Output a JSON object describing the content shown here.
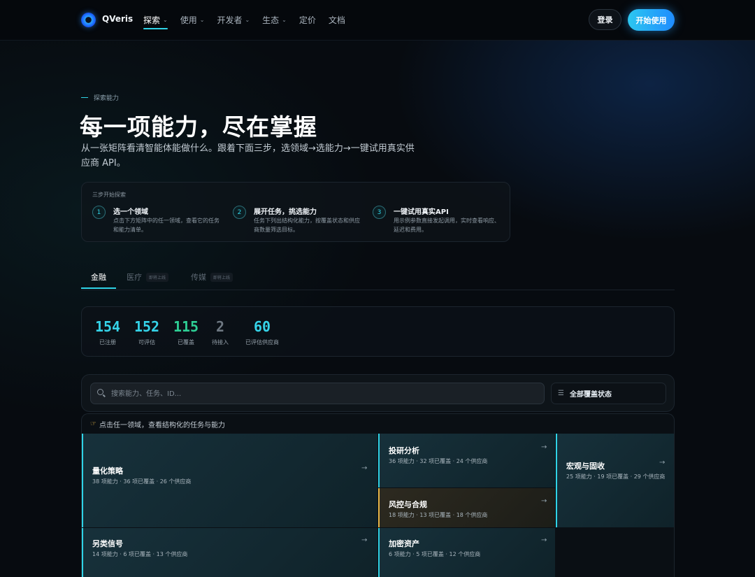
{
  "nav": {
    "brand": "QVeris",
    "items": [
      {
        "label": "探索",
        "dropdown": true,
        "active": true
      },
      {
        "label": "使用",
        "dropdown": true
      },
      {
        "label": "开发者",
        "dropdown": true
      },
      {
        "label": "生态",
        "dropdown": true
      },
      {
        "label": "定价",
        "dropdown": false
      },
      {
        "label": "文档",
        "dropdown": false
      }
    ],
    "login": "登录",
    "start": "开始使用"
  },
  "hero": {
    "eyebrow": "探索能力",
    "title": "每一项能力，尽在掌握",
    "description": "从一张矩阵看清智能体能做什么。跟着下面三步，选领域→选能力→一键试用真实供应商 API。"
  },
  "steps": {
    "label": "三步开始探索",
    "items": [
      {
        "num": "1",
        "title": "选一个领域",
        "desc": "点击下方矩阵中的任一领域，查看它的任务和能力清单。"
      },
      {
        "num": "2",
        "title": "展开任务，挑选能力",
        "desc": "任务下列出结构化能力，按覆盖状态和供应商数量筛选目标。"
      },
      {
        "num": "3",
        "title": "一键试用真实API",
        "desc": "用示例参数直接发起调用，实时查看响应、延迟和费用。"
      }
    ]
  },
  "tabs": [
    {
      "label": "金融",
      "active": true,
      "badge": ""
    },
    {
      "label": "医疗",
      "active": false,
      "badge": "即将上线"
    },
    {
      "label": "传媒",
      "active": false,
      "badge": "即将上线"
    }
  ],
  "stats": [
    {
      "value": "154",
      "label": "已注册",
      "color": "#35d3e8"
    },
    {
      "value": "152",
      "label": "可评估",
      "color": "#35d3e8"
    },
    {
      "value": "115",
      "label": "已覆盖",
      "color": "#2ecf95"
    },
    {
      "value": "2",
      "label": "待接入",
      "color": "#6e7882"
    },
    {
      "value": "60",
      "label": "已评估供应商",
      "color": "#35d3e8"
    }
  ],
  "search": {
    "placeholder": "搜索能力、任务、ID...",
    "filter_label": "全部覆盖状态",
    "filter_icon": "sliders-icon"
  },
  "grid": {
    "hint_icon": "pointing-hand-icon",
    "hint": "点击任一领域，查看结构化的任务与能力",
    "tiles": [
      {
        "title": "量化策略",
        "meta": "38 项能力 · 36 项已覆盖 · 26 个供应商"
      },
      {
        "title": "投研分析",
        "meta": "36 项能力 · 32 项已覆盖 · 24 个供应商"
      },
      {
        "title": "宏观与固收",
        "meta": "25 项能力 · 19 项已覆盖 · 29 个供应商"
      },
      {
        "title": "风控与合规",
        "meta": "18 项能力 · 13 项已覆盖 · 18 个供应商"
      },
      {
        "title": "另类信号",
        "meta": "14 项能力 · 6 项已覆盖 · 13 个供应商"
      },
      {
        "title": "加密资产",
        "meta": "6 项能力 · 5 项已覆盖 · 12 个供应商"
      }
    ]
  },
  "colors": {
    "accent": "#2fd3e6",
    "covered": "#2ecf95",
    "warning": "#e9b84a",
    "background": "#070b10"
  }
}
